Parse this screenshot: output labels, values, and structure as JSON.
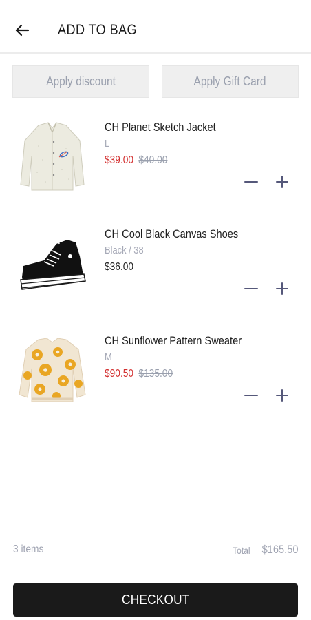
{
  "header": {
    "title": "ADD TO BAG",
    "back_icon": "arrow-left-icon"
  },
  "actions": {
    "discount_label": "Apply discount",
    "gift_card_label": "Apply Gift Card"
  },
  "items": [
    {
      "name": "CH Planet Sketch Jacket",
      "variant": "L",
      "price": "$39.00",
      "original_price": "$40.00",
      "on_sale": true,
      "image": "jacket-image"
    },
    {
      "name": "CH Cool Black Canvas Shoes",
      "variant": "Black / 38",
      "price": "$36.00",
      "original_price": "",
      "on_sale": false,
      "image": "shoes-image"
    },
    {
      "name": "CH Sunflower Pattern Sweater",
      "variant": "M",
      "price": "$90.50",
      "original_price": "$135.00",
      "on_sale": true,
      "image": "sweater-image"
    }
  ],
  "summary": {
    "item_count": "3 items",
    "total_label": "Total",
    "total_value": "$165.50"
  },
  "checkout": {
    "label": "CHECKOUT"
  },
  "colors": {
    "sale_price": "#d32f2f",
    "muted_text": "#a0a4b2",
    "checkout_bg": "#1a1a1a",
    "action_bg": "#efefef"
  }
}
